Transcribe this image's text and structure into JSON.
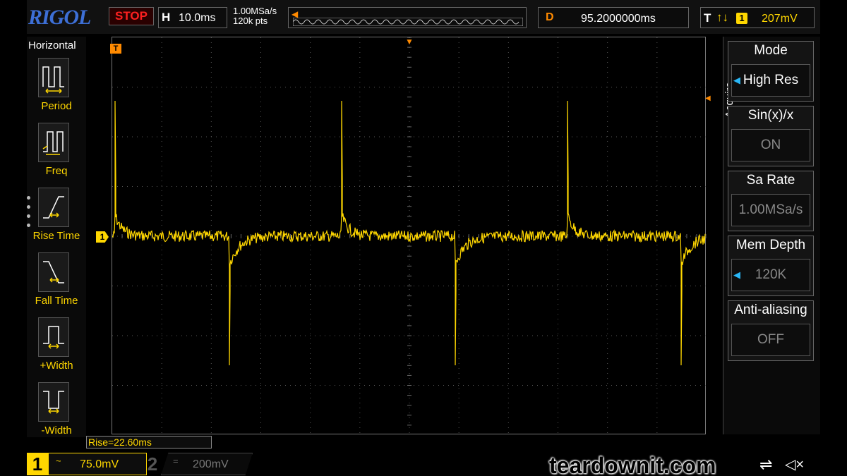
{
  "brand": "RIGOL",
  "status": "STOP",
  "timebase": {
    "label": "H",
    "value": "10.0ms"
  },
  "acquisition_summary": {
    "sample_rate": "1.00MSa/s",
    "points": "120k pts"
  },
  "delay": {
    "label": "D",
    "value": "95.2000000ms"
  },
  "trigger": {
    "label": "T",
    "channel": "1",
    "level": "207mV"
  },
  "left_menu": {
    "title": "Horizontal",
    "items": [
      {
        "label": "Period",
        "icon": "period-icon"
      },
      {
        "label": "Freq",
        "icon": "frequency-icon"
      },
      {
        "label": "Rise Time",
        "icon": "rise-time-icon"
      },
      {
        "label": "Fall Time",
        "icon": "fall-time-icon"
      },
      {
        "label": "+Width",
        "icon": "positive-width-icon"
      },
      {
        "label": "-Width",
        "icon": "negative-width-icon"
      }
    ]
  },
  "right_menu": {
    "tab": "Acquire",
    "items": [
      {
        "label": "Mode",
        "value": "High Res"
      },
      {
        "label": "Sin(x)/x",
        "value": "ON"
      },
      {
        "label": "Sa Rate",
        "value": "1.00MSa/s"
      },
      {
        "label": "Mem Depth",
        "value": "120K"
      },
      {
        "label": "Anti-aliasing",
        "value": "OFF"
      }
    ]
  },
  "measurement": "Rise=22.60ms",
  "channels": [
    {
      "number": "1",
      "coupling": "~",
      "scale": "75.0mV"
    },
    {
      "number": "2",
      "coupling": "=",
      "scale": "200mV"
    }
  ],
  "watermark": "teardownit.com",
  "colors": {
    "ch1": "#ffd700",
    "trigger": "#ff8a00",
    "brand": "#3d6fd6",
    "stop": "#ff2020"
  }
}
